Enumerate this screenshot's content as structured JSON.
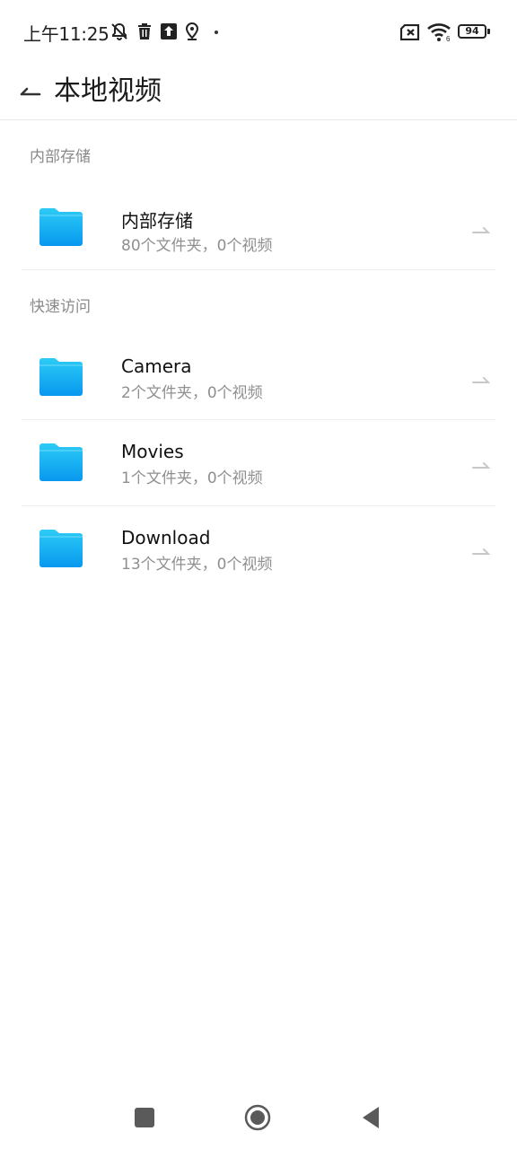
{
  "status_bar": {
    "time": "上午11:25",
    "icons": [
      "bell-off-icon",
      "trash-icon",
      "upload-icon",
      "location-icon"
    ],
    "battery": "94",
    "wifi_badge": "6"
  },
  "header": {
    "title": "本地视频"
  },
  "sections": [
    {
      "label": "内部存储",
      "items": [
        {
          "title": "内部存储",
          "subtitle": "80个文件夹，0个视频"
        }
      ]
    },
    {
      "label": "快速访问",
      "items": [
        {
          "title": "Camera",
          "subtitle": "2个文件夹，0个视频"
        },
        {
          "title": "Movies",
          "subtitle": "1个文件夹，0个视频"
        },
        {
          "title": "Download",
          "subtitle": "13个文件夹，0个视频"
        }
      ]
    }
  ],
  "colors": {
    "folder_top": "#29c8f4",
    "folder_bottom": "#0a9ef0",
    "secondary_text": "#8f8f8f"
  }
}
